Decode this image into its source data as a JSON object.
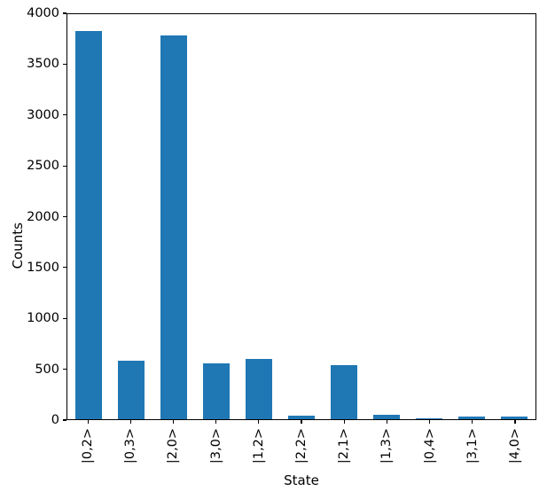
{
  "chart_data": {
    "type": "bar",
    "title": "",
    "xlabel": "State",
    "ylabel": "Counts",
    "categories": [
      "|0,2>",
      "|0,3>",
      "|2,0>",
      "|3,0>",
      "|1,2>",
      "|2,2>",
      "|2,1>",
      "|1,3>",
      "|0,4>",
      "|3,1>",
      "|4,0>"
    ],
    "values": [
      3820,
      578,
      3775,
      550,
      595,
      35,
      530,
      44,
      10,
      28,
      22
    ],
    "series": [
      {
        "name": "Counts",
        "values": [
          3820,
          578,
          3775,
          550,
          595,
          35,
          530,
          44,
          10,
          28,
          22
        ]
      }
    ],
    "ylim": [
      0,
      4000
    ],
    "yticks": [
      0,
      500,
      1000,
      1500,
      2000,
      2500,
      3000,
      3500,
      4000
    ],
    "ytick_labels": [
      "0",
      "500",
      "1000",
      "1500",
      "2000",
      "2500",
      "3000",
      "3500",
      "4000"
    ],
    "grid": false,
    "legend": null,
    "bar_color": "#1f77b4"
  }
}
